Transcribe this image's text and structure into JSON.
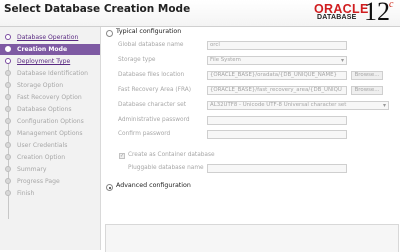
{
  "header": {
    "title": "Select Database Creation Mode",
    "logo": {
      "brand": "ORACLE",
      "product": "DATABASE",
      "version": "12",
      "version_suffix": "c"
    }
  },
  "steps": [
    {
      "label": "Database Operation",
      "state": "link"
    },
    {
      "label": "Creation Mode",
      "state": "current"
    },
    {
      "label": "Deployment Type",
      "state": "link"
    },
    {
      "label": "Database Identification",
      "state": "disabled"
    },
    {
      "label": "Storage Option",
      "state": "disabled"
    },
    {
      "label": "Fast Recovery Option",
      "state": "disabled"
    },
    {
      "label": "Database Options",
      "state": "disabled"
    },
    {
      "label": "Configuration Options",
      "state": "disabled"
    },
    {
      "label": "Management Options",
      "state": "disabled"
    },
    {
      "label": "User Credentials",
      "state": "disabled"
    },
    {
      "label": "Creation Option",
      "state": "disabled"
    },
    {
      "label": "Summary",
      "state": "disabled"
    },
    {
      "label": "Progress Page",
      "state": "disabled"
    },
    {
      "label": "Finish",
      "state": "disabled"
    }
  ],
  "content": {
    "typical_label": "Typical configuration",
    "advanced_label": "Advanced configuration",
    "selected_mode": "advanced",
    "fields": {
      "global_db_name": {
        "label": "Global database name",
        "value": "orcl"
      },
      "storage_type": {
        "label": "Storage type",
        "value": "File System"
      },
      "db_files_location": {
        "label": "Database files location",
        "value": "{ORACLE_BASE}/oradata/{DB_UNIQUE_NAME}",
        "browse": "Browse..."
      },
      "fra": {
        "label": "Fast Recovery Area (FRA)",
        "value": "{ORACLE_BASE}/fast_recovery_area/{DB_UNIQU",
        "browse": "Browse..."
      },
      "charset": {
        "label": "Database character set",
        "value": "AL32UTF8 - Unicode UTF-8 Universal character set"
      },
      "admin_password": {
        "label": "Administrative password",
        "value": ""
      },
      "confirm_password": {
        "label": "Confirm password",
        "value": ""
      },
      "container_db": {
        "label": "Create as Container database",
        "checked": true
      },
      "pdb_name": {
        "label": "Pluggable database name",
        "value": ""
      }
    }
  },
  "colors": {
    "accent": "#7e5aa3",
    "oracle_red": "#d01d1f"
  }
}
